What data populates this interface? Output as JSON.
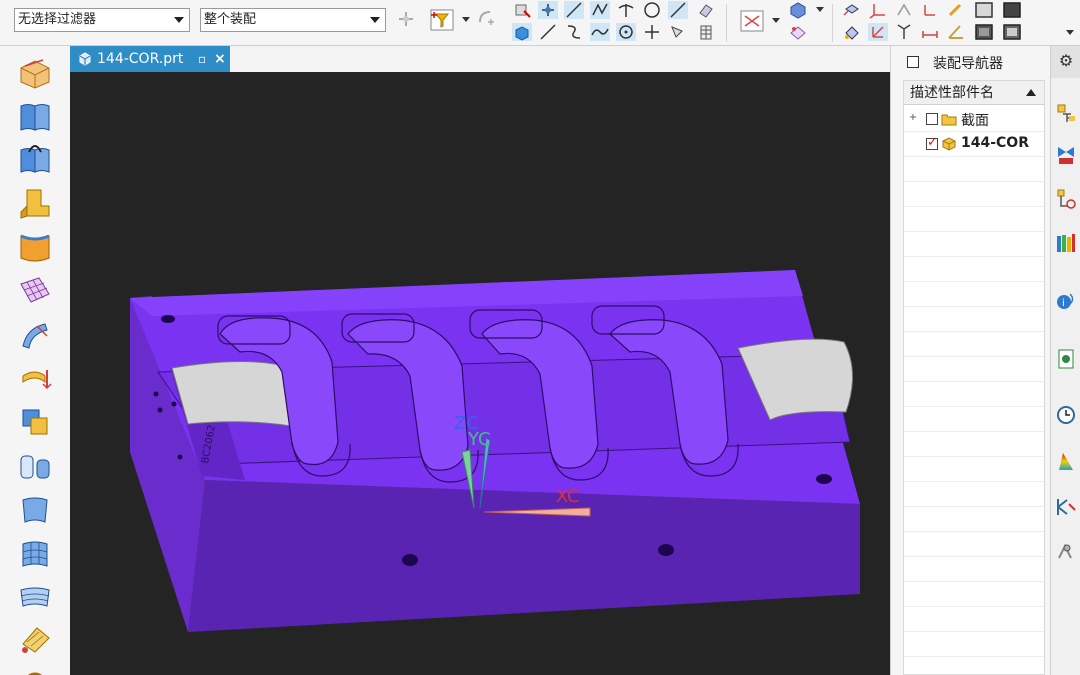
{
  "toolbar": {
    "selection_filter": {
      "value": "无选择过滤器"
    },
    "assembly_scope": {
      "value": "整个装配"
    },
    "icons": [
      "snap-point-icon",
      "selection-filter-icon",
      "snap-endpoint-icon",
      "snap-midpoint-icon",
      "snap-intersection-icon",
      "snap-center-icon",
      "snap-quadrant-icon",
      "snap-curve-icon",
      "snap-face-icon",
      "snap-grid-icon",
      "view-fit-icon",
      "render-style-icon",
      "show-hide-icon",
      "layer-icon",
      "wcs-icon"
    ]
  },
  "left_toolbar": {
    "icons": [
      "block-icon",
      "surface-icon",
      "sweep-icon",
      "extrude-icon",
      "face-icon",
      "mesh-surface-icon",
      "offset-surface-icon",
      "trim-icon",
      "boolean-icon",
      "cylinder-icon",
      "ruled-surface-icon",
      "studio-surface-icon",
      "through-curves-icon",
      "styled-blend-icon",
      "more-icon"
    ]
  },
  "document_tab": {
    "title": "144-COR.prt",
    "close": "×"
  },
  "viewport": {
    "background": "#242424",
    "model_color": "#7a33f0",
    "axis_labels": {
      "zc": "ZC",
      "yc": "YC",
      "xc": "XC"
    },
    "engraving": "BC2062"
  },
  "assembly_navigator": {
    "title": "装配导航器",
    "column": "描述性部件名",
    "rows": [
      {
        "name": "截面",
        "expand": "+",
        "checked": false,
        "icon": "folder-icon",
        "bold": false
      },
      {
        "name": "144-COR",
        "expand": "",
        "checked": true,
        "icon": "part-icon",
        "bold": true
      }
    ]
  },
  "resource_bar": {
    "icons": [
      "settings-icon",
      "assembly-navigator-icon",
      "constraint-navigator-icon",
      "part-navigator-icon",
      "reuse-library-icon",
      "hd3d-tools-icon",
      "web-browser-icon",
      "history-icon",
      "process-studio-icon",
      "roles-icon",
      "system-materials-icon"
    ]
  }
}
